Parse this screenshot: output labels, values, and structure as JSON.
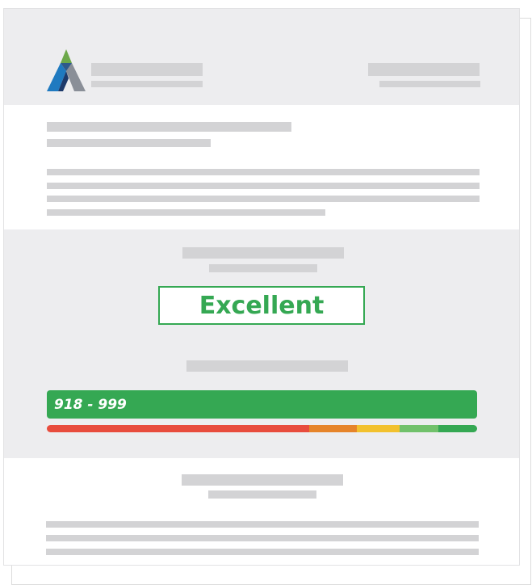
{
  "rating": {
    "label": "Excellent",
    "color": "#35a853"
  },
  "score_range": {
    "label": "918 - 999"
  },
  "spectrum": {
    "segments": [
      {
        "color": "#e84c3d",
        "fraction": 0.61
      },
      {
        "color": "#e6842a",
        "fraction": 0.11
      },
      {
        "color": "#f2c12e",
        "fraction": 0.1
      },
      {
        "color": "#71c16b",
        "fraction": 0.09
      },
      {
        "color": "#35a853",
        "fraction": 0.09
      }
    ]
  },
  "logo": {
    "icon": "mountain-logo-icon",
    "colors": [
      "#6ca84a",
      "#1f7ac0",
      "#8a8f98",
      "#1d3a6b"
    ]
  },
  "colors": {
    "page_background": "#ededef",
    "placeholder": "#d3d3d5"
  }
}
